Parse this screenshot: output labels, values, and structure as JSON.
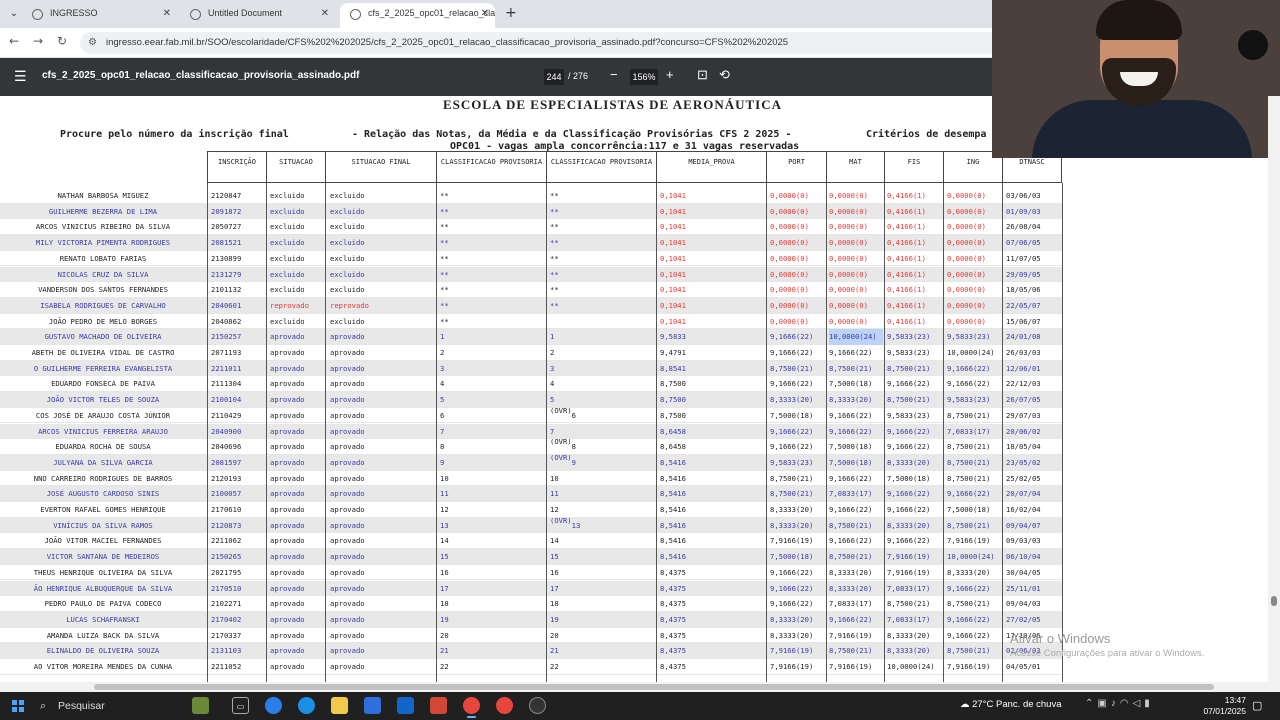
{
  "browser": {
    "tabs": [
      {
        "title": "INGRESSO",
        "active": false
      },
      {
        "title": "Untitled Document",
        "active": false
      },
      {
        "title": "cfs_2_2025_opc01_relacao_clas",
        "active": true
      }
    ],
    "url": "ingresso.eear.fab.mil.br/SOO/escolaridade/CFS%202%202025/cfs_2_2025_opc01_relacao_classificacao_provisoria_assinado.pdf?concurso=CFS%202%202025"
  },
  "pdf": {
    "filename": "cfs_2_2025_opc01_relacao_classificacao_provisoria_assinado.pdf",
    "page": "244",
    "page_total": "/ 276",
    "zoom": "156%"
  },
  "document": {
    "title": "ESCOLA DE ESPECIALISTAS DE AERONÁUTICA",
    "line_left": "Procure pelo número da inscrição final",
    "line_center": "- Relação das Notas, da Média e da Classificação Provisórias CFS 2 2025 -",
    "line_right": "Critérios de desempa",
    "line_sub": "OPC01 - vagas ampla concorrência:117 e 31 vagas reservadas",
    "headers": {
      "inscricao": "INSCRIÇÃO",
      "situacao": "SITUACAO",
      "situacao_final": "SITUACAO FINAL",
      "class1": "CLASSIFICACAO PROVISORIA",
      "class2": "CLASSIFICACAO PROVISORIA",
      "media": "MEDIA_PROVA",
      "port": "PORT",
      "mat": "MAT",
      "fis": "FIS",
      "ing": "ING",
      "dnasc": "DTNASC"
    },
    "rows": [
      {
        "name": "NATHAN BARBOSA MIGUEZ",
        "insc": "2120847",
        "sit": "excluido",
        "sitf": "excluido",
        "c1": "**",
        "c2": "**",
        "media": "0,1041",
        "port": "0,0000(0)",
        "mat": "0,0000(0)",
        "fis": "0,4166(1)",
        "ing": "0,0000(0)",
        "dn": "03/06/03"
      },
      {
        "name": "GUILHERME BEZERRA DE LIMA",
        "insc": "2091872",
        "sit": "excluido",
        "sitf": "excluido",
        "c1": "**",
        "c2": "**",
        "media": "0,1041",
        "port": "0,0000(0)",
        "mat": "0,0000(0)",
        "fis": "0,4166(1)",
        "ing": "0,0000(0)",
        "dn": "01/09/03"
      },
      {
        "name": "ARCOS VINICIUS RIBEIRO DA SILVA",
        "insc": "2050727",
        "sit": "excluido",
        "sitf": "excluido",
        "c1": "**",
        "c2": "**",
        "media": "0,1041",
        "port": "0,0000(0)",
        "mat": "0,0000(0)",
        "fis": "0,4166(1)",
        "ing": "0,0000(0)",
        "dn": "26/08/04"
      },
      {
        "name": "MILY VICTORIA PIMENTA RODRIGUES",
        "insc": "2081521",
        "sit": "excluido",
        "sitf": "excluido",
        "c1": "**",
        "c2": "**",
        "media": "0,1041",
        "port": "0,0000(0)",
        "mat": "0,0000(0)",
        "fis": "0,4166(1)",
        "ing": "0,0000(0)",
        "dn": "07/06/05"
      },
      {
        "name": "RENATO LOBATO FARIAS",
        "insc": "2130899",
        "sit": "excluido",
        "sitf": "excluido",
        "c1": "**",
        "c2": "**",
        "media": "0,1041",
        "port": "0,0000(0)",
        "mat": "0,0000(0)",
        "fis": "0,4166(1)",
        "ing": "0,0000(0)",
        "dn": "11/07/05"
      },
      {
        "name": "NICOLAS CRUZ DA SILVA",
        "insc": "2131279",
        "sit": "excluido",
        "sitf": "excluido",
        "c1": "**",
        "c2": "**",
        "media": "0,1041",
        "port": "0,0000(0)",
        "mat": "0,0000(0)",
        "fis": "0,4166(1)",
        "ing": "0,0000(0)",
        "dn": "29/09/05"
      },
      {
        "name": "VANDERSON DOS SANTOS FERNANDES",
        "insc": "2101132",
        "sit": "excluido",
        "sitf": "excluido",
        "c1": "**",
        "c2": "**",
        "media": "0,1041",
        "port": "0,0000(0)",
        "mat": "0,0000(0)",
        "fis": "0,4166(1)",
        "ing": "0,0000(0)",
        "dn": "18/05/06"
      },
      {
        "name": "ISABELA RODRIGUES DE CARVALHO",
        "insc": "2040601",
        "sit": "reprovado",
        "sitf": "reprovado",
        "c1": "**",
        "c2": "**",
        "media": "0,1041",
        "port": "0,0000(0)",
        "mat": "0,0000(0)",
        "fis": "0,4166(1)",
        "ing": "0,0000(0)",
        "dn": "22/05/07"
      },
      {
        "name": "JOÃO PEDRO DE MELO BORGES",
        "insc": "2040862",
        "sit": "excluido",
        "sitf": "excluido",
        "c1": "**",
        "c2": "",
        "media": "0,1041",
        "port": "0,0000(0)",
        "mat": "0,0000(0)",
        "fis": "0,4166(1)",
        "ing": "0,0000(0)",
        "dn": "15/06/07"
      },
      {
        "name": "GUSTAVO MACHADO DE OLIVEIRA",
        "insc": "2150257",
        "sit": "aprovado",
        "sitf": "aprovado",
        "c1": "1",
        "c2": "1",
        "media": "9,5833",
        "port": "9,1666(22)",
        "mat": "10,0000(24)",
        "fis": "9,5833(23)",
        "ing": "9,5833(23)",
        "dn": "24/01/08"
      },
      {
        "name": "ABETH DE OLIVEIRA VIDAL DE CASTRO",
        "insc": "2071193",
        "sit": "aprovado",
        "sitf": "aprovado",
        "c1": "2",
        "c2": "2",
        "media": "9,4791",
        "port": "9,1666(22)",
        "mat": "9,1666(22)",
        "fis": "9,5833(23)",
        "ing": "10,0000(24)",
        "dn": "26/03/03"
      },
      {
        "name": "O GUILHERME FERREIRA EVANGELISTA",
        "insc": "2211011",
        "sit": "aprovado",
        "sitf": "aprovado",
        "c1": "3",
        "c2": "3",
        "media": "8,8541",
        "port": "8,7500(21)",
        "mat": "8,7500(21)",
        "fis": "8,7500(21)",
        "ing": "9,1666(22)",
        "dn": "12/06/01"
      },
      {
        "name": "EDUARDO FONSECA DE PAIVA",
        "insc": "2111304",
        "sit": "aprovado",
        "sitf": "aprovado",
        "c1": "4",
        "c2": "4",
        "media": "8,7500",
        "port": "9,1666(22)",
        "mat": "7,5000(18)",
        "fis": "9,1666(22)",
        "ing": "9,1666(22)",
        "dn": "22/12/03"
      },
      {
        "name": "JOÃO VICTOR TELES DE SOUZA",
        "insc": "2100104",
        "sit": "aprovado",
        "sitf": "aprovado",
        "c1": "5",
        "c2": "5",
        "media": "8,7500",
        "port": "8,3333(20)",
        "mat": "8,3333(20)",
        "fis": "8,7500(21)",
        "ing": "9,5833(23)",
        "dn": "26/07/05"
      },
      {
        "name": "COS JOSÉ DE ARAUJO COSTA JÚNIOR",
        "insc": "2110429",
        "sit": "aprovado",
        "sitf": "aprovado",
        "c1": "6",
        "c2": "6",
        "ovr": "(OVR)",
        "media": "8,7500",
        "port": "7,5000(18)",
        "mat": "9,1666(22)",
        "fis": "9,5833(23)",
        "ing": "8,7500(21)",
        "dn": "29/07/03"
      },
      {
        "name": "ARCOS VINICIUS FERREIRA ARAUJO",
        "insc": "2040900",
        "sit": "aprovado",
        "sitf": "aprovado",
        "c1": "7",
        "c2": "7",
        "media": "8,6458",
        "port": "9,1666(22)",
        "mat": "9,1666(22)",
        "fis": "9,1666(22)",
        "ing": "7,0833(17)",
        "dn": "20/06/02"
      },
      {
        "name": "EDUARDA ROCHA DE SOUSA",
        "insc": "2040696",
        "sit": "aprovado",
        "sitf": "aprovado",
        "c1": "8",
        "c2": "8",
        "ovr": "(OVR)",
        "media": "8,6458",
        "port": "9,1666(22)",
        "mat": "7,5000(18)",
        "fis": "9,1666(22)",
        "ing": "8,7500(21)",
        "dn": "18/05/04"
      },
      {
        "name": "JULYANA DA SILVA GARCIA",
        "insc": "2081597",
        "sit": "aprovado",
        "sitf": "aprovado",
        "c1": "9",
        "c2": "9",
        "ovr": "(OVR)",
        "media": "8,5416",
        "port": "9,5833(23)",
        "mat": "7,5000(18)",
        "fis": "8,3333(20)",
        "ing": "8,7500(21)",
        "dn": "23/05/02"
      },
      {
        "name": "NNO CARREIRO RODRIGUES DE BARROS",
        "insc": "2120193",
        "sit": "aprovado",
        "sitf": "aprovado",
        "c1": "10",
        "c2": "10",
        "media": "8,5416",
        "port": "8,7500(21)",
        "mat": "9,1666(22)",
        "fis": "7,5000(18)",
        "ing": "8,7500(21)",
        "dn": "25/02/05"
      },
      {
        "name": "JOSÉ AUGUSTO CARDOSO SINIS",
        "insc": "2100057",
        "sit": "aprovado",
        "sitf": "aprovado",
        "c1": "11",
        "c2": "11",
        "media": "8,5416",
        "port": "8,7500(21)",
        "mat": "7,0833(17)",
        "fis": "9,1666(22)",
        "ing": "9,1666(22)",
        "dn": "20/07/04"
      },
      {
        "name": "EVERTON RAFAEL GOMES HENRIQUE",
        "insc": "2170610",
        "sit": "aprovado",
        "sitf": "aprovado",
        "c1": "12",
        "c2": "12",
        "media": "8,5416",
        "port": "8,3333(20)",
        "mat": "9,1666(22)",
        "fis": "9,1666(22)",
        "ing": "7,5000(18)",
        "dn": "16/02/04"
      },
      {
        "name": "VINÍCIUS DA SILVA RAMOS",
        "insc": "2120873",
        "sit": "aprovado",
        "sitf": "aprovado",
        "c1": "13",
        "c2": "13",
        "ovr": "(OVR)",
        "media": "8,5416",
        "port": "8,3333(20)",
        "mat": "8,7500(21)",
        "fis": "8,3333(20)",
        "ing": "8,7500(21)",
        "dn": "09/04/07"
      },
      {
        "name": "JOÃO VITOR MACIEL FERNANDES",
        "insc": "2211062",
        "sit": "aprovado",
        "sitf": "aprovado",
        "c1": "14",
        "c2": "14",
        "media": "8,5416",
        "port": "7,9166(19)",
        "mat": "9,1666(22)",
        "fis": "9,1666(22)",
        "ing": "7,9166(19)",
        "dn": "09/03/03"
      },
      {
        "name": "VICTOR SANTANA DE MEDEIROS",
        "insc": "2150265",
        "sit": "aprovado",
        "sitf": "aprovado",
        "c1": "15",
        "c2": "15",
        "media": "8,5416",
        "port": "7,5000(18)",
        "mat": "8,7500(21)",
        "fis": "7,9166(19)",
        "ing": "10,0000(24)",
        "dn": "06/10/04"
      },
      {
        "name": "THEUS HENRIQUE OLIVEIRA DA SILVA",
        "insc": "2021795",
        "sit": "aprovado",
        "sitf": "aprovado",
        "c1": "16",
        "c2": "16",
        "media": "8,4375",
        "port": "9,1666(22)",
        "mat": "8,3333(20)",
        "fis": "7,9166(19)",
        "ing": "8,3333(20)",
        "dn": "30/04/05"
      },
      {
        "name": "ÃO HENRIQUE ALBUQUERQUE DA SILVA",
        "insc": "2170510",
        "sit": "aprovado",
        "sitf": "aprovado",
        "c1": "17",
        "c2": "17",
        "media": "8,4375",
        "port": "9,1666(22)",
        "mat": "8,3333(20)",
        "fis": "7,0833(17)",
        "ing": "9,1666(22)",
        "dn": "25/11/01"
      },
      {
        "name": "PEDRO PAULO DE PAIVA CODECO",
        "insc": "2102271",
        "sit": "aprovado",
        "sitf": "aprovado",
        "c1": "18",
        "c2": "18",
        "media": "8,4375",
        "port": "9,1666(22)",
        "mat": "7,0833(17)",
        "fis": "8,7500(21)",
        "ing": "8,7500(21)",
        "dn": "09/04/03"
      },
      {
        "name": "LUCAS SCHAFRANSKI",
        "insc": "2170402",
        "sit": "aprovado",
        "sitf": "aprovado",
        "c1": "19",
        "c2": "19",
        "media": "8,4375",
        "port": "8,3333(20)",
        "mat": "9,1666(22)",
        "fis": "7,0833(17)",
        "ing": "9,1666(22)",
        "dn": "27/02/05"
      },
      {
        "name": "AMANDA LUIZA BACK DA SILVA",
        "insc": "2170337",
        "sit": "aprovado",
        "sitf": "aprovado",
        "c1": "20",
        "c2": "20",
        "media": "8,4375",
        "port": "8,3333(20)",
        "mat": "7,9166(19)",
        "fis": "8,3333(20)",
        "ing": "9,1666(22)",
        "dn": "17/10/06"
      },
      {
        "name": "ELINALDO DE OLIVEIRA SOUZA",
        "insc": "2131103",
        "sit": "aprovado",
        "sitf": "aprovado",
        "c1": "21",
        "c2": "21",
        "media": "8,4375",
        "port": "7,9166(19)",
        "mat": "8,7500(21)",
        "fis": "8,3333(20)",
        "ing": "8,7500(21)",
        "dn": "02/06/03"
      },
      {
        "name": "AO VITOR MOREIRA MENDES DA CUNHA",
        "insc": "2211052",
        "sit": "aprovado",
        "sitf": "aprovado",
        "c1": "22",
        "c2": "22",
        "media": "8,4375",
        "port": "7,9166(19)",
        "mat": "7,9166(19)",
        "fis": "10,0000(24)",
        "ing": "7,9166(19)",
        "dn": "04/05/01"
      }
    ]
  },
  "watermark": {
    "line1": "Ativar o Windows",
    "line2": "Acesse Configurações para ativar o Windows."
  },
  "taskbar": {
    "search_label": "Pesquisar",
    "weather": "27°C  Panc. de chuva",
    "time": "13:47",
    "date": "07/01/2025"
  },
  "colors": {
    "red": "#e53935",
    "blue_text": "#3a3aa8",
    "pdf_toolbar": "#323639",
    "taskbar": "#202020"
  }
}
